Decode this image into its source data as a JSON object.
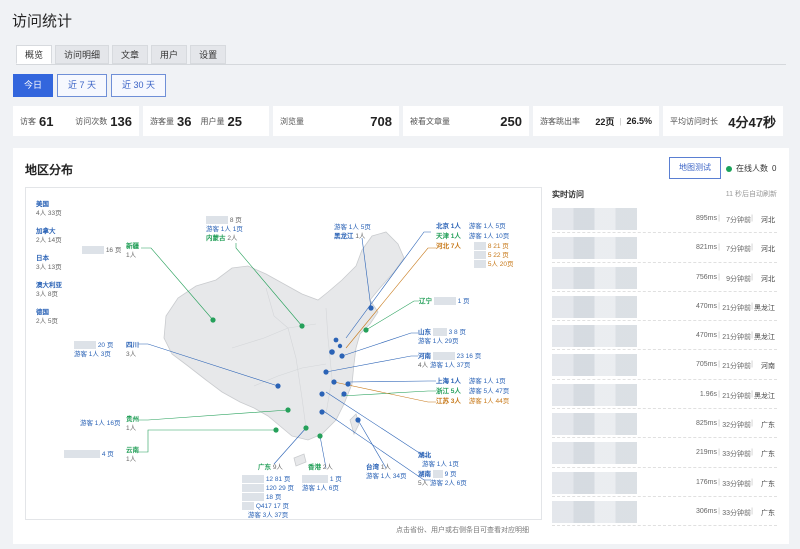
{
  "page_title": "访问统计",
  "tabs": [
    {
      "label": "概览",
      "active": true
    },
    {
      "label": "访问明细",
      "active": false
    },
    {
      "label": "文章",
      "active": false
    },
    {
      "label": "用户",
      "active": false
    },
    {
      "label": "设置",
      "active": false
    }
  ],
  "ranges": [
    {
      "label": "今日",
      "active": true
    },
    {
      "label": "近 7 天",
      "active": false
    },
    {
      "label": "近 30 天",
      "active": false
    }
  ],
  "stats": {
    "visitors_label": "访客",
    "visitors": "61",
    "visits_label": "访问次数",
    "visits": "136",
    "guests_label": "游客量",
    "guests": "36",
    "users_label": "用户量",
    "users": "25",
    "views_label": "浏览量",
    "views": "708",
    "articles_label": "被看文章量",
    "articles": "250",
    "bounce_label": "游客跳出率",
    "bounce_pages": "22页",
    "bounce_sep": "|",
    "bounce_rate": "26.5%",
    "avg_label": "平均访问时长",
    "avg": "4分47秒"
  },
  "panel": {
    "title": "地区分布",
    "map_test_button": "地图测试",
    "online_label": "在线人数",
    "online_count": "0",
    "hint": "点击省份、用户或右侧条目可查看对应明细",
    "colors": {
      "dot_blue": "#2b63b6",
      "dot_green": "#25a05a",
      "map_fill": "#e7e8ea",
      "map_stroke": "#c9cbce"
    }
  },
  "foreign": [
    {
      "name": "美国",
      "detail": "4人 33页"
    },
    {
      "name": "加拿大",
      "detail": "2人 14页"
    },
    {
      "name": "日本",
      "detail": "3人 13页"
    },
    {
      "name": "澳大利亚",
      "detail": "3人 8页"
    },
    {
      "name": "德国",
      "detail": "2人 5页"
    }
  ],
  "map_labels": {
    "neimenggu_pages": "8 页",
    "neimenggu_guest": "游客 1人 1页",
    "neimenggu_name": "内蒙古",
    "neimenggu_count": "2人",
    "heilongjiang_guest": "游客 1人 5页",
    "heilongjiang_name": "黑龙江",
    "heilongjiang_count": "1人",
    "xinjiang_pages": "16 页",
    "xinjiang_name": "新疆",
    "xinjiang_count": "1人",
    "beijing": "北京 1人",
    "beijing_guest": "游客 1人 5页",
    "tianjin": "天津 1人",
    "tianjin_guest": "游客 1人 10页",
    "hebei": "河北 7人",
    "hebei_p1": "8  21 页",
    "hebei_p2": "5  22 页",
    "hebei_p3": "5人 20页",
    "liaoning": "辽宁",
    "liaoning_pages": "1 页",
    "shandong": "山东",
    "shandong_pages": "3  8 页",
    "shandong_guest": "游客 1人 29页",
    "henan": "河南",
    "henan_pages": "23  16 页",
    "henan_count": "4人",
    "henan_guest": "游客 1人 37页",
    "sichuan_pages": "20 页",
    "sichuan_guest": "游客 1人 3页",
    "sichuan_name": "四川",
    "sichuan_count": "3人",
    "shanghai": "上海 1人",
    "shanghai_guest": "游客 1人 1页",
    "zhejiang": "浙江 5人",
    "zhejiang_guest": "游客 5人 47页",
    "jiangsu": "江苏 3人",
    "jiangsu_guest": "游客 1人 44页",
    "guizhou_guest": "游客 1人 16页",
    "guizhou_name": "贵州",
    "guizhou_count": "1人",
    "yunnan_pages": "4 页",
    "yunnan_name": "云南",
    "yunnan_count": "1人",
    "hubei": "湖北",
    "hubei_guest": "游客 1人 1页",
    "hunan": "湖南",
    "hunan_pages": "9 页",
    "hunan_count": "5人",
    "hunan_guest": "游客 2人 6页",
    "guangdong": "广东",
    "guangdong_count": "9人",
    "guangdong_p1": "12  81 页",
    "guangdong_p2": "120  29 页",
    "guangdong_p3": "18 页",
    "guangdong_p4": "Q417  17 页",
    "guangdong_guest": "游客 3人 37页",
    "xianggang": "香港",
    "xianggang_count": "2人",
    "xianggang_p1": "1 页",
    "xianggang_guest": "游客 1人 6页",
    "taiwan": "台湾",
    "taiwan_count": "1人",
    "taiwan_guest": "游客 1人 34页"
  },
  "realtime": {
    "title": "实时访问",
    "subtitle": "11 秒后自动刷新",
    "rows": [
      {
        "ms": "895ms",
        "ago": "7分钟前",
        "region": "河北"
      },
      {
        "ms": "821ms",
        "ago": "7分钟前",
        "region": "河北"
      },
      {
        "ms": "756ms",
        "ago": "9分钟前",
        "region": "河北"
      },
      {
        "ms": "470ms",
        "ago": "21分钟前",
        "region": "黑龙江"
      },
      {
        "ms": "470ms",
        "ago": "21分钟前",
        "region": "黑龙江"
      },
      {
        "ms": "705ms",
        "ago": "21分钟前",
        "region": "河南"
      },
      {
        "ms": "1.96s",
        "ago": "21分钟前",
        "region": "黑龙江"
      },
      {
        "ms": "825ms",
        "ago": "32分钟前",
        "region": "广东"
      },
      {
        "ms": "219ms",
        "ago": "33分钟前",
        "region": "广东"
      },
      {
        "ms": "176ms",
        "ago": "33分钟前",
        "region": "广东"
      },
      {
        "ms": "306ms",
        "ago": "33分钟前",
        "region": "广东"
      }
    ]
  }
}
